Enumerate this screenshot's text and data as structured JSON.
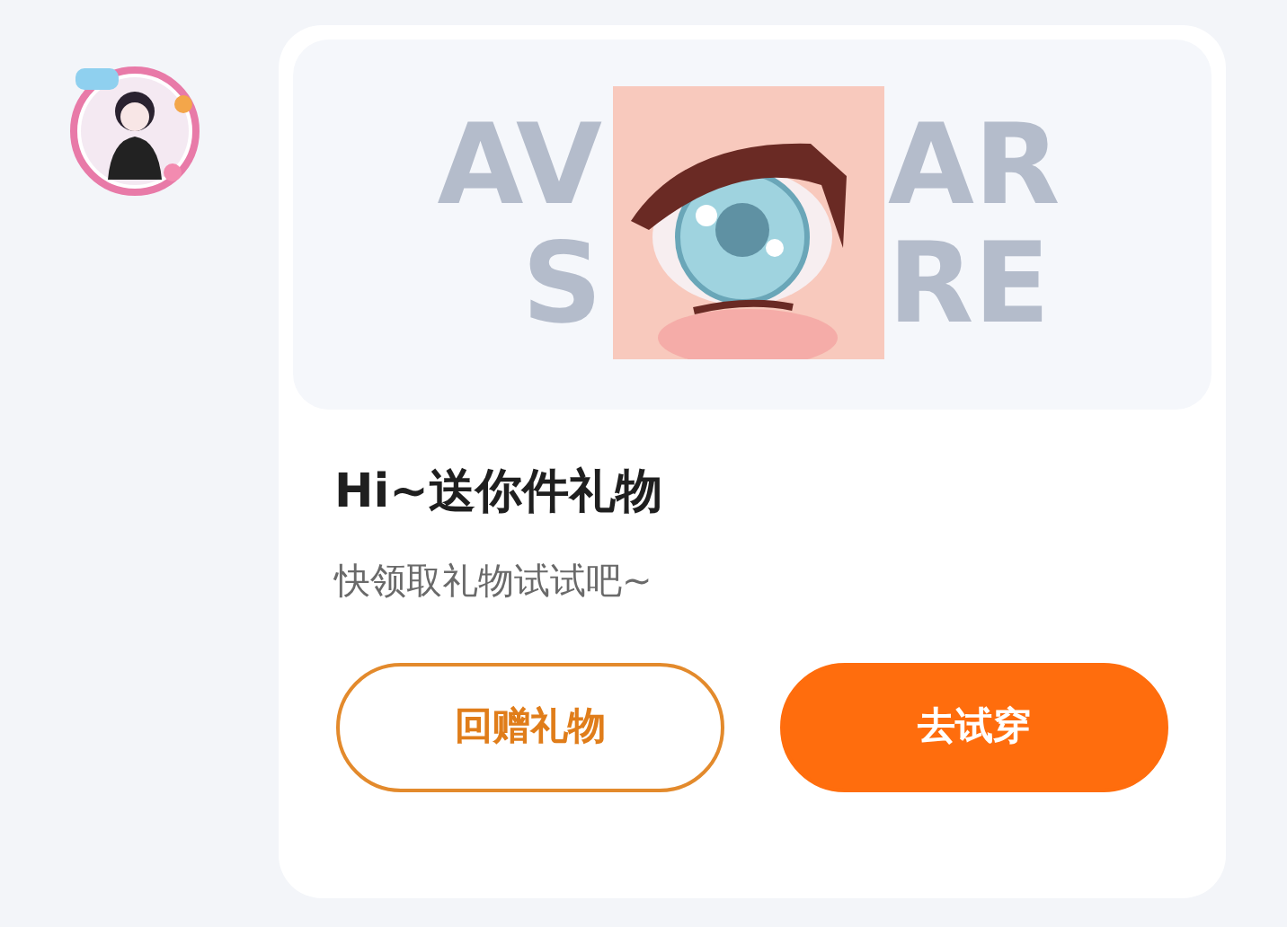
{
  "card": {
    "banner_text": [
      "AV",
      "AR",
      "S",
      "RE"
    ],
    "title": "Hi~送你件礼物",
    "subtitle": "快领取礼物试试吧~",
    "buttons": [
      {
        "label": "回赠礼物",
        "kind": "outline"
      },
      {
        "label": "去试穿",
        "kind": "filled"
      }
    ]
  }
}
